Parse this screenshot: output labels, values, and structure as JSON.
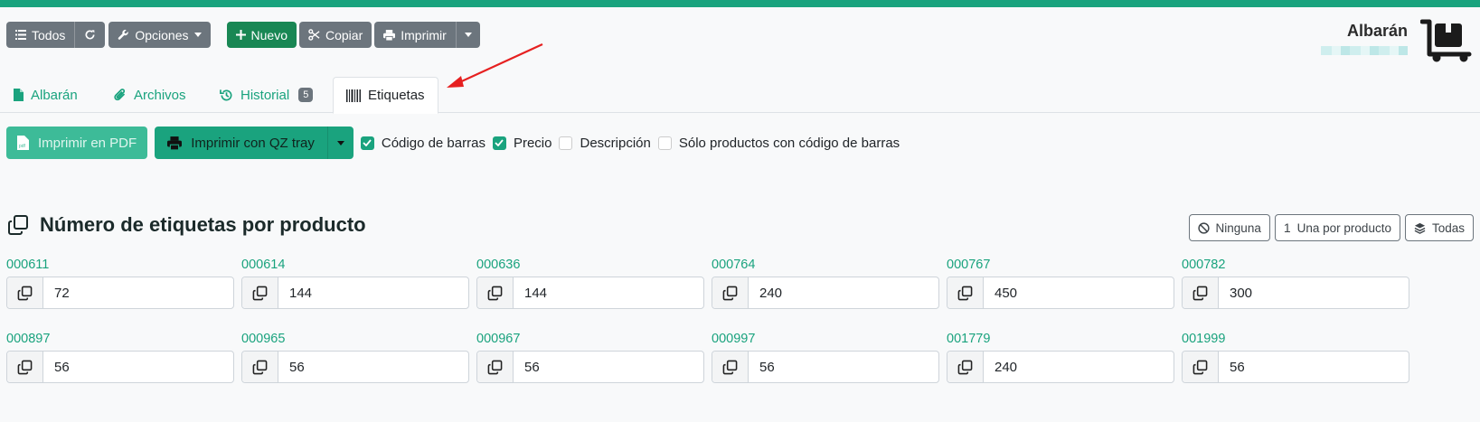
{
  "toolbar": {
    "todos_label": "Todos",
    "opciones_label": "Opciones",
    "nuevo_label": "Nuevo",
    "copiar_label": "Copiar",
    "imprimir_label": "Imprimir"
  },
  "brand": {
    "title": "Albarán"
  },
  "tabs": [
    {
      "label": "Albarán"
    },
    {
      "label": "Archivos"
    },
    {
      "label": "Historial",
      "badge": "5"
    },
    {
      "label": "Etiquetas"
    }
  ],
  "actions": {
    "pdf_label": "Imprimir en PDF",
    "qz_label": "Imprimir con QZ tray",
    "checkboxes": [
      {
        "label": "Código de barras",
        "checked": true
      },
      {
        "label": "Precio",
        "checked": true
      },
      {
        "label": "Descripción",
        "checked": false
      },
      {
        "label": "Sólo productos con código de barras",
        "checked": false
      }
    ]
  },
  "section": {
    "title": "Número de etiquetas por producto",
    "ninguna_label": "Ninguna",
    "una_icon_text": "1",
    "una_label": "Una por producto",
    "todas_label": "Todas"
  },
  "products": [
    {
      "code": "000611",
      "qty": "72"
    },
    {
      "code": "000614",
      "qty": "144"
    },
    {
      "code": "000636",
      "qty": "144"
    },
    {
      "code": "000764",
      "qty": "240"
    },
    {
      "code": "000767",
      "qty": "450"
    },
    {
      "code": "000782",
      "qty": "300"
    },
    {
      "code": "000897",
      "qty": "56"
    },
    {
      "code": "000965",
      "qty": "56"
    },
    {
      "code": "000967",
      "qty": "56"
    },
    {
      "code": "000997",
      "qty": "56"
    },
    {
      "code": "001779",
      "qty": "240"
    },
    {
      "code": "001999",
      "qty": "56"
    }
  ],
  "colors": {
    "accent": "#1aa37e",
    "secondary": "#6c757d",
    "success": "#198754"
  }
}
